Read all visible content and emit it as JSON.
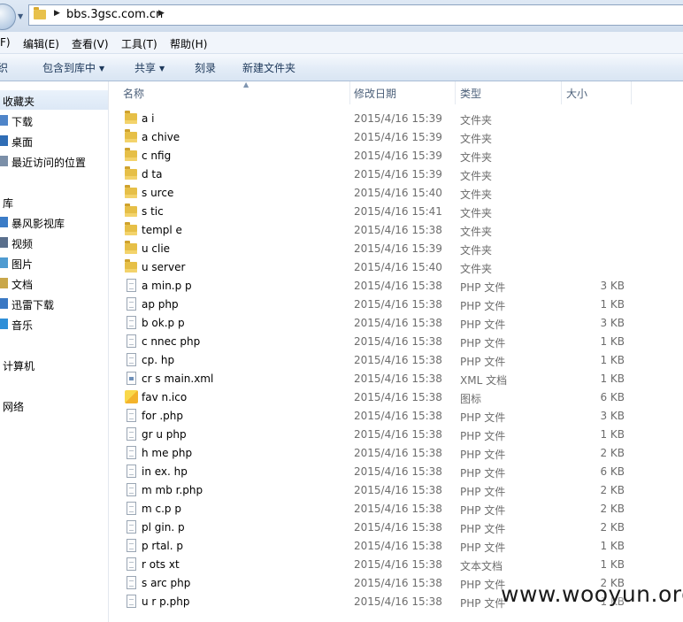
{
  "address": {
    "path": "bbs.3gsc.com.cn"
  },
  "menu": [
    {
      "label": "F)"
    },
    {
      "label": "编辑(E)"
    },
    {
      "label": "查看(V)"
    },
    {
      "label": "工具(T)"
    },
    {
      "label": "帮助(H)"
    }
  ],
  "toolbar": [
    {
      "label": "织"
    },
    {
      "label": "包含到库中"
    },
    {
      "label": "共享"
    },
    {
      "label": "刻录"
    },
    {
      "label": "新建文件夹"
    }
  ],
  "nav": {
    "favorites": "收藏夹",
    "downloads": "下载",
    "desktop": "桌面",
    "recent": "最近访问的位置",
    "libraries": "库",
    "storm": "暴风影视库",
    "videos": "视频",
    "pictures": "图片",
    "documents": "文档",
    "thunder": "迅雷下载",
    "music": "音乐",
    "computer": "计算机",
    "network": "网络"
  },
  "columns": {
    "name": "名称",
    "date": "修改日期",
    "type": "类型",
    "size": "大小"
  },
  "files": [
    {
      "name": "a i",
      "date": "2015/4/16 15:39",
      "type": "文件夹",
      "size": "",
      "kind": "folder"
    },
    {
      "name": "a chive",
      "date": "2015/4/16 15:39",
      "type": "文件夹",
      "size": "",
      "kind": "folder"
    },
    {
      "name": "c nfig",
      "date": "2015/4/16 15:39",
      "type": "文件夹",
      "size": "",
      "kind": "folder"
    },
    {
      "name": "d ta",
      "date": "2015/4/16 15:39",
      "type": "文件夹",
      "size": "",
      "kind": "folder"
    },
    {
      "name": "s urce",
      "date": "2015/4/16 15:40",
      "type": "文件夹",
      "size": "",
      "kind": "folder"
    },
    {
      "name": "s tic",
      "date": "2015/4/16 15:41",
      "type": "文件夹",
      "size": "",
      "kind": "folder"
    },
    {
      "name": "templ e",
      "date": "2015/4/16 15:38",
      "type": "文件夹",
      "size": "",
      "kind": "folder"
    },
    {
      "name": "u clie",
      "date": "2015/4/16 15:39",
      "type": "文件夹",
      "size": "",
      "kind": "folder"
    },
    {
      "name": "u server",
      "date": "2015/4/16 15:40",
      "type": "文件夹",
      "size": "",
      "kind": "folder"
    },
    {
      "name": "a min.p p",
      "date": "2015/4/16 15:38",
      "type": "PHP 文件",
      "size": "3 KB",
      "kind": "file"
    },
    {
      "name": "ap php",
      "date": "2015/4/16 15:38",
      "type": "PHP 文件",
      "size": "1 KB",
      "kind": "file"
    },
    {
      "name": "b ok.p p",
      "date": "2015/4/16 15:38",
      "type": "PHP 文件",
      "size": "3 KB",
      "kind": "file"
    },
    {
      "name": "c nnec php",
      "date": "2015/4/16 15:38",
      "type": "PHP 文件",
      "size": "1 KB",
      "kind": "file"
    },
    {
      "name": "cp. hp",
      "date": "2015/4/16 15:38",
      "type": "PHP 文件",
      "size": "1 KB",
      "kind": "file"
    },
    {
      "name": "cr s main.xml",
      "date": "2015/4/16 15:38",
      "type": "XML 文档",
      "size": "1 KB",
      "kind": "xml"
    },
    {
      "name": "fav n.ico",
      "date": "2015/4/16 15:38",
      "type": "图标",
      "size": "6 KB",
      "kind": "ico"
    },
    {
      "name": "for .php",
      "date": "2015/4/16 15:38",
      "type": "PHP 文件",
      "size": "3 KB",
      "kind": "file"
    },
    {
      "name": "gr u php",
      "date": "2015/4/16 15:38",
      "type": "PHP 文件",
      "size": "1 KB",
      "kind": "file"
    },
    {
      "name": "h me php",
      "date": "2015/4/16 15:38",
      "type": "PHP 文件",
      "size": "2 KB",
      "kind": "file"
    },
    {
      "name": "in ex. hp",
      "date": "2015/4/16 15:38",
      "type": "PHP 文件",
      "size": "6 KB",
      "kind": "file"
    },
    {
      "name": "m mb r.php",
      "date": "2015/4/16 15:38",
      "type": "PHP 文件",
      "size": "2 KB",
      "kind": "file"
    },
    {
      "name": "m c.p p",
      "date": "2015/4/16 15:38",
      "type": "PHP 文件",
      "size": "2 KB",
      "kind": "file"
    },
    {
      "name": "pl gin. p",
      "date": "2015/4/16 15:38",
      "type": "PHP 文件",
      "size": "2 KB",
      "kind": "file"
    },
    {
      "name": "p rtal. p",
      "date": "2015/4/16 15:38",
      "type": "PHP 文件",
      "size": "1 KB",
      "kind": "file"
    },
    {
      "name": "r ots xt",
      "date": "2015/4/16 15:38",
      "type": "文本文档",
      "size": "1 KB",
      "kind": "file"
    },
    {
      "name": "s arc php",
      "date": "2015/4/16 15:38",
      "type": "PHP 文件",
      "size": "2 KB",
      "kind": "file"
    },
    {
      "name": "u r p.php",
      "date": "2015/4/16 15:38",
      "type": "PHP 文件",
      "size": "1 KB",
      "kind": "file"
    }
  ],
  "watermark": "www.wooyun.org",
  "colors": {
    "folder": "#e6bf47",
    "toolbar": "#dce7f4",
    "accent": "#1e395b"
  }
}
